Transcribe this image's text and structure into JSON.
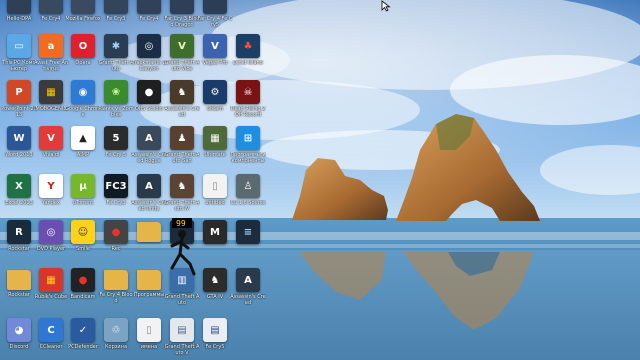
{
  "desktop": {
    "icons": [
      {
        "label": "Hello-DPA",
        "glyph": "",
        "bg": "#2f3f55",
        "fg": "#ffffff",
        "icon": "app-icon"
      },
      {
        "label": "Fe Cry4",
        "glyph": "",
        "bg": "#384a5e",
        "fg": "#ffffff",
        "icon": "game-icon"
      },
      {
        "label": "Mozilla Firefox",
        "glyph": "",
        "bg": "#3a4a60",
        "fg": "#ffffff",
        "icon": "firefox-icon"
      },
      {
        "label": "Fe Cry3",
        "glyph": "",
        "bg": "#33455b",
        "fg": "#ffffff",
        "icon": "game-icon"
      },
      {
        "label": "Fe Cry4",
        "glyph": "",
        "bg": "#30425a",
        "fg": "#ffffff",
        "icon": "game-icon"
      },
      {
        "label": "Far Cry 3 Blood Dragon",
        "glyph": "",
        "bg": "#2e4058",
        "fg": "#ffffff",
        "icon": "game-icon"
      },
      {
        "label": "Far Cry 4 Fe Cry5",
        "glyph": "",
        "bg": "#2c3e56",
        "fg": "#ffffff",
        "icon": "game-icon"
      },
      {
        "label": "This PC Компьютер",
        "glyph": "▭",
        "bg": "#5aa9e6",
        "fg": "#ffffff",
        "icon": "computer-icon"
      },
      {
        "label": "Avast Free Antivirus",
        "glyph": "a",
        "bg": "#f26b21",
        "fg": "#ffffff",
        "icon": "avast-icon"
      },
      {
        "label": "Opera",
        "glyph": "O",
        "bg": "#e0202c",
        "fg": "#ffffff",
        "icon": "opera-icon"
      },
      {
        "label": "Grand Theft Auto",
        "glyph": "✱",
        "bg": "#2a3d52",
        "fg": "#9fd4ff",
        "icon": "game-icon"
      },
      {
        "label": "Trackmania 2 Canyon",
        "glyph": "◎",
        "bg": "#1c2e45",
        "fg": "#ffffff",
        "icon": "trackmania-icon"
      },
      {
        "label": "Grand Theft Auto Vice",
        "glyph": "V",
        "bg": "#3e6d2e",
        "fg": "#e8f7c5",
        "icon": "gta-icon"
      },
      {
        "label": "Vegas Pro",
        "glyph": "V",
        "bg": "#3b63b0",
        "fg": "#ffffff",
        "icon": "vegas-icon"
      },
      {
        "label": "Dead Island",
        "glyph": "♣",
        "bg": "#1b3f66",
        "fg": "#ff4a3a",
        "icon": "dead-island-icon"
      },
      {
        "label": "PowerPoint 2013",
        "glyph": "P",
        "bg": "#d24726",
        "fg": "#ffffff",
        "icon": "powerpoint-icon"
      },
      {
        "label": "MOBOGENIE",
        "glyph": "▦",
        "bg": "#3b3b3b",
        "fg": "#ffcc00",
        "icon": "mobogenie-icon"
      },
      {
        "label": "Google Chrome",
        "glyph": "◉",
        "bg": "#2e7bd6",
        "fg": "#ffffff",
        "icon": "chrome-icon"
      },
      {
        "label": "Plants vs Zombies",
        "glyph": "❀",
        "bg": "#3a8a2e",
        "fg": "#cfff9a",
        "icon": "plants-icon"
      },
      {
        "label": "OBS Studio",
        "glyph": "●",
        "bg": "#1f1f1f",
        "fg": "#ffffff",
        "icon": "obs-icon"
      },
      {
        "label": "Assassin's Creed",
        "glyph": "♞",
        "bg": "#4a3a2a",
        "fg": "#ffffff",
        "icon": "game-icon"
      },
      {
        "label": "Steam",
        "glyph": "⚙",
        "bg": "#1b3c6b",
        "fg": "#ffffff",
        "icon": "steam-icon"
      },
      {
        "label": "Dead Rising 2 Off Record",
        "glyph": "☠",
        "bg": "#7a1414",
        "fg": "#ffffff",
        "icon": "dead-rising-icon"
      },
      {
        "label": "Word 2013",
        "glyph": "W",
        "bg": "#2b5797",
        "fg": "#ffffff",
        "icon": "word-icon"
      },
      {
        "label": "Vivaldi",
        "glyph": "V",
        "bg": "#e33a3a",
        "fg": "#ffffff",
        "icon": "vivaldi-icon"
      },
      {
        "label": "AIMP",
        "glyph": "▲",
        "bg": "#ffffff",
        "fg": "#222222",
        "icon": "aimp-icon"
      },
      {
        "label": "Fe Cry 5",
        "glyph": "5",
        "bg": "#2b2b2b",
        "fg": "#ffffff",
        "icon": "game-icon"
      },
      {
        "label": "Assassin's Creed Rogue",
        "glyph": "A",
        "bg": "#3a4a5a",
        "fg": "#ffffff",
        "icon": "assassin-icon"
      },
      {
        "label": "Grand Theft Auto San",
        "glyph": "♟",
        "bg": "#5a4030",
        "fg": "#ffffff",
        "icon": "gta-icon"
      },
      {
        "label": "Ultimate",
        "glyph": "▦",
        "bg": "#4f6a3a",
        "fg": "#ffffff",
        "icon": "app-icon"
      },
      {
        "label": "Программы и компоненты",
        "glyph": "⊞",
        "bg": "#1f8de0",
        "fg": "#ffffff",
        "icon": "windows-icon"
      },
      {
        "label": "Excel 2013",
        "glyph": "X",
        "bg": "#207245",
        "fg": "#ffffff",
        "icon": "excel-icon"
      },
      {
        "label": "Yandex",
        "glyph": "Y",
        "bg": "#ffffff",
        "fg": "#e61400",
        "icon": "yandex-icon"
      },
      {
        "label": "uTorrent",
        "glyph": "μ",
        "bg": "#76b82a",
        "fg": "#ffffff",
        "icon": "utorrent-icon"
      },
      {
        "label": "Fe Cry3",
        "glyph": "FC3",
        "bg": "#0f1a24",
        "fg": "#ffffff",
        "icon": "far-cry-icon"
      },
      {
        "label": "Assassin's Creed Unity",
        "glyph": "A",
        "bg": "#2a3a4a",
        "fg": "#ffffff",
        "icon": "assassin-icon"
      },
      {
        "label": "Grand Theft Auto IV",
        "glyph": "♞",
        "bg": "#5b4433",
        "fg": "#ffffff",
        "icon": "gta-icon"
      },
      {
        "label": "untitled",
        "glyph": "▯",
        "bg": "#f2f2f2",
        "fg": "#888888",
        "icon": "document-icon"
      },
      {
        "label": "CS 1.6 Source",
        "glyph": "♙",
        "bg": "#5a6a70",
        "fg": "#ffffff",
        "icon": "counter-strike-icon"
      },
      {
        "label": "Rockstar",
        "glyph": "R",
        "bg": "#1a2b3c",
        "fg": "#ffffff",
        "icon": "rockstar-icon"
      },
      {
        "label": "DVD Player",
        "glyph": "◎",
        "bg": "#6a4fb0",
        "fg": "#ffffff",
        "icon": "disc-icon"
      },
      {
        "label": "Smile",
        "glyph": "☺",
        "bg": "#ffd21a",
        "fg": "#333333",
        "icon": "smile-icon"
      },
      {
        "label": "Rec",
        "glyph": "●",
        "bg": "#444444",
        "fg": "#e8332a",
        "icon": "record-icon"
      },
      {
        "label": "",
        "glyph": "",
        "bg": "#e6b54a",
        "fg": "#ffffff",
        "icon": "folder-icon"
      },
      {
        "label": "",
        "glyph": "",
        "bg": "#1a2b3c",
        "fg": "#ffffff",
        "icon": "game-icon"
      },
      {
        "label": "",
        "glyph": "M",
        "bg": "#2a2a2a",
        "fg": "#ffffff",
        "icon": "app-icon"
      },
      {
        "label": "",
        "glyph": "≡",
        "bg": "#1c2c3c",
        "fg": "#9fd4ff",
        "icon": "app-icon"
      },
      {
        "label": "Rockstar",
        "glyph": "",
        "bg": "#e6b54a",
        "fg": "#ffffff",
        "icon": "folder-icon"
      },
      {
        "label": "Rubik's Cube",
        "glyph": "▦",
        "bg": "#d8362a",
        "fg": "#ffd21a",
        "icon": "rubik-icon"
      },
      {
        "label": "Bandicam",
        "glyph": "●",
        "bg": "#222222",
        "fg": "#e8332a",
        "icon": "bandicam-icon"
      },
      {
        "label": "Fe Cry 4 Blood",
        "glyph": "",
        "bg": "#e6b54a",
        "fg": "#ffffff",
        "icon": "folder-icon"
      },
      {
        "label": "Программы",
        "glyph": "",
        "bg": "#e6b54a",
        "fg": "#ffffff",
        "icon": "folder-icon"
      },
      {
        "label": "Grand Theft Auto",
        "glyph": "▥",
        "bg": "#3a6ea8",
        "fg": "#ffffff",
        "icon": "app-icon"
      },
      {
        "label": "GTA IV",
        "glyph": "♞",
        "bg": "#2c2c2c",
        "fg": "#ffffff",
        "icon": "gta-icon"
      },
      {
        "label": "Assassin's Creed",
        "glyph": "A",
        "bg": "#2a3a4a",
        "fg": "#ffffff",
        "icon": "assassin-icon"
      },
      {
        "label": "Discord",
        "glyph": "◕",
        "bg": "#7289da",
        "fg": "#ffffff",
        "icon": "discord-icon"
      },
      {
        "label": "CCleaner",
        "glyph": "C",
        "bg": "#2f77d0",
        "fg": "#ffffff",
        "icon": "ccleaner-icon"
      },
      {
        "label": "PCDefender",
        "glyph": "✓",
        "bg": "#2a5aa0",
        "fg": "#ffffff",
        "icon": "defender-icon"
      },
      {
        "label": "Корзина",
        "glyph": "♲",
        "bg": "#7aa3c4",
        "fg": "#ffffff",
        "icon": "recycle-bin-icon"
      },
      {
        "label": "имена",
        "glyph": "▯",
        "bg": "#f2f2f2",
        "fg": "#888888",
        "icon": "document-icon"
      },
      {
        "label": "Grand Theft Auto V",
        "glyph": "▤",
        "bg": "#e4e8ee",
        "fg": "#4a6a8a",
        "icon": "document-icon"
      },
      {
        "label": "Fe Cry5",
        "glyph": "▤",
        "bg": "#e9eef4",
        "fg": "#2a4a7a",
        "icon": "document-icon"
      }
    ]
  },
  "overlay": {
    "runner_badge": "99"
  }
}
